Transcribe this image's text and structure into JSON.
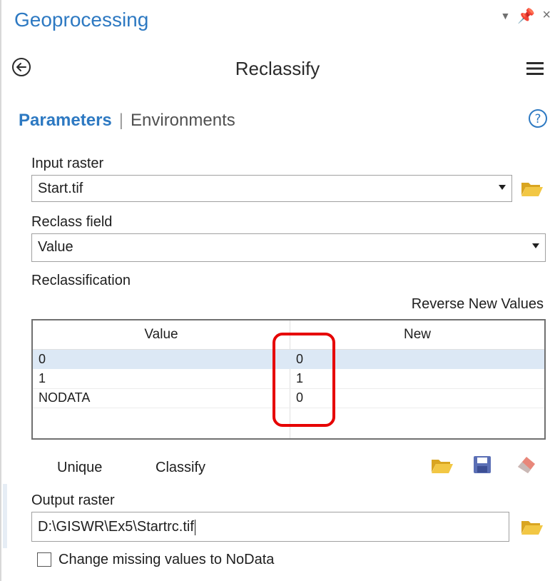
{
  "window": {
    "title": "Geoprocessing",
    "controls": {
      "pin_glyph": "↓Ι",
      "close_glyph": "×"
    }
  },
  "tool": {
    "title": "Reclassify"
  },
  "tabs": {
    "parameters": "Parameters",
    "separator": "|",
    "environments": "Environments"
  },
  "params": {
    "input_raster": {
      "label": "Input raster",
      "value": "Start.tif"
    },
    "reclass_field": {
      "label": "Reclass field",
      "value": "Value"
    },
    "reclassification": {
      "label": "Reclassification",
      "reverse_label": "Reverse New Values",
      "columns": [
        "Value",
        "New"
      ],
      "rows": [
        {
          "value": "0",
          "new": "0"
        },
        {
          "value": "1",
          "new": "1"
        },
        {
          "value": "NODATA",
          "new": "0"
        }
      ],
      "selected_row": 0
    },
    "buttons": {
      "unique": "Unique",
      "classify": "Classify"
    },
    "output_raster": {
      "label": "Output raster",
      "value": "D:\\GISWR\\Ex5\\Startrc.tif"
    },
    "change_missing": {
      "label": "Change missing values to NoData",
      "checked": false
    }
  },
  "icons": {
    "back": "back-arrow-icon",
    "menu": "hamburger-menu-icon",
    "help": "help-icon",
    "folder": "folder-open-icon",
    "save": "save-icon",
    "eraser": "eraser-icon"
  },
  "colors": {
    "accent": "#2d79c2",
    "folder": "#e8b830",
    "selected_row": "#dce8f5",
    "highlight": "#e60000"
  }
}
